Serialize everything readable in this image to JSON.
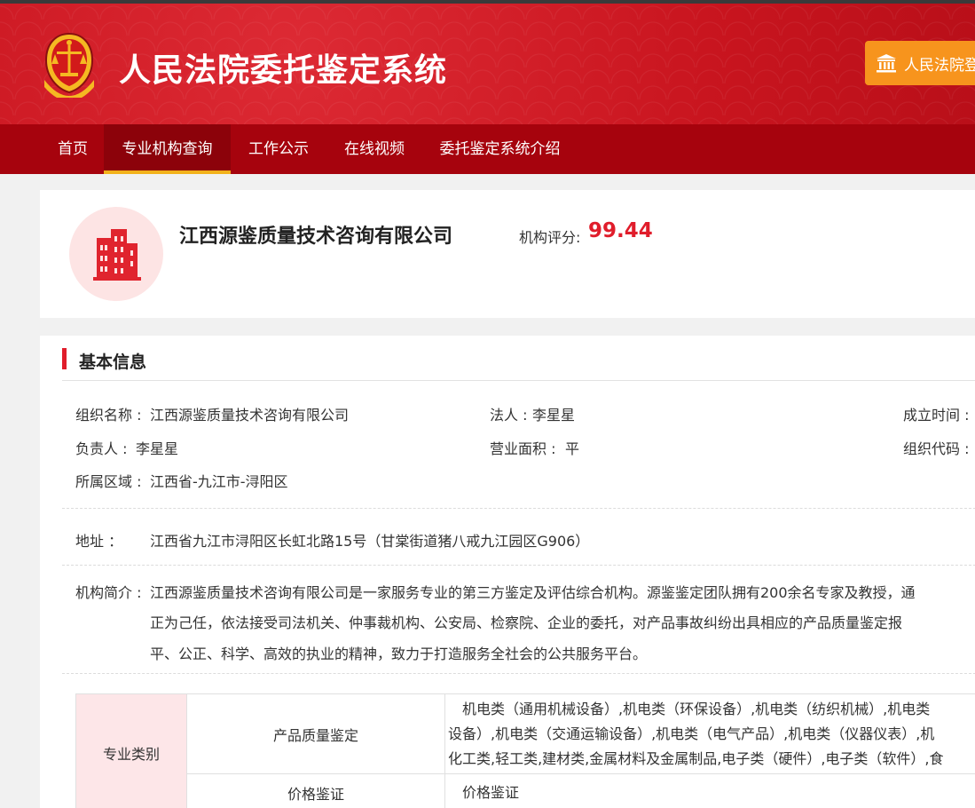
{
  "header": {
    "site_title": "人民法院委托鉴定系统",
    "login_button": "人民法院登",
    "colors": {
      "header_red": "#c9151f",
      "nav_red": "#a6030d",
      "accent_orange": "#f7941d",
      "active_underline": "#f2b21b",
      "score_red": "#e01d2b"
    }
  },
  "nav": {
    "items": [
      {
        "label": "首页"
      },
      {
        "label": "专业机构查询"
      },
      {
        "label": "工作公示"
      },
      {
        "label": "在线视频"
      },
      {
        "label": "委托鉴定系统介绍"
      }
    ],
    "active": "专业机构查询"
  },
  "org": {
    "name": "江西源鉴质量技术咨询有限公司",
    "score_label": "机构评分:",
    "score_value": "99.44",
    "avatar_icon": "building-icon"
  },
  "basic_info": {
    "section_title": "基本信息",
    "org_name_label": "组织名称 :",
    "org_name_value": "江西源鉴质量技术咨询有限公司",
    "legal_person_label": "法人 :",
    "legal_person_value": "李星星",
    "established_label": "成立时间 :",
    "manager_label": "负责人 :",
    "manager_value": "李星星",
    "area_label": "营业面积 :",
    "area_value": "平",
    "org_code_label": "组织代码 :",
    "region_label": "所属区域 :",
    "region_value": "江西省-九江市-浔阳区",
    "address_label": "地址 ：",
    "address_value": "江西省九江市浔阳区长虹北路15号（甘棠街道猪八戒九江园区G906）",
    "intro_label": "机构简介 :",
    "intro_lines": [
      "江西源鉴质量技术咨询有限公司是一家服务专业的第三方鉴定及评估综合机构。源鉴鉴定团队拥有200余名专家及教授，通",
      "正为己任，依法接受司法机关、仲事裁机构、公安局、检察院、企业的委托，对产品事故纠纷出具相应的产品质量鉴定报",
      "平、公正、科学、高效的执业的精神，致力于打造服务全社会的公共服务平台。"
    ]
  },
  "specialty": {
    "category_label": "专业类别",
    "rows": [
      {
        "sub": "产品质量鉴定",
        "lines": [
          "　机电类（通用机械设备）,机电类（环保设备）,机电类（纺织机械）,机电类",
          "设备）,机电类（交通运输设备）,机电类（电气产品）,机电类（仪器仪表）,机",
          "化工类,轻工类,建材类,金属材料及金属制品,电子类（硬件）,电子类（软件）,食"
        ]
      },
      {
        "sub": "价格鉴证",
        "lines": [
          "　价格鉴证"
        ]
      }
    ]
  }
}
